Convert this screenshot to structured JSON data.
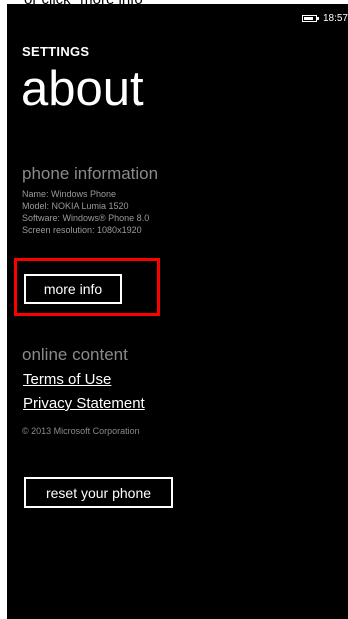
{
  "caption": "or click \"more info\"",
  "status_bar": {
    "time": "18:57",
    "battery_icon": "battery-icon"
  },
  "header": {
    "app_title": "SETTINGS",
    "page_title": "about"
  },
  "phone_information": {
    "heading": "phone information",
    "details": [
      "Name: Windows Phone",
      "Model: NOKIA Lumia 1520",
      "Software: Windows® Phone 8.0",
      "Screen resolution: 1080x1920"
    ],
    "more_info_label": "more info"
  },
  "online_content": {
    "heading": "online content",
    "links": [
      "Terms of Use",
      "Privacy Statement"
    ],
    "copyright": "© 2013 Microsoft Corporation"
  },
  "reset_label": "reset your phone",
  "colors": {
    "background": "#000000",
    "foreground": "#ffffff",
    "subtle_text": "#8a8a8a",
    "highlight": "#ff0000"
  }
}
